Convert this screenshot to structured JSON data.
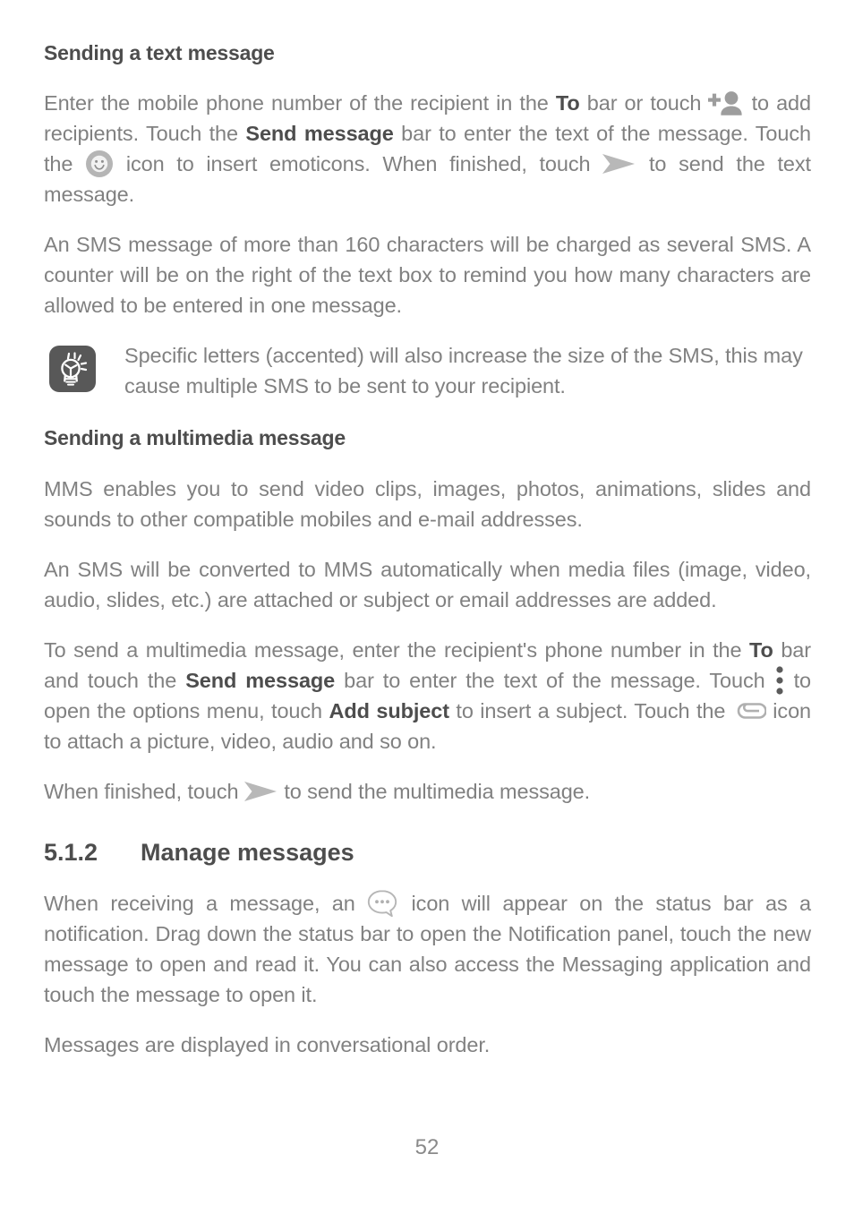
{
  "document": {
    "page_number": "52",
    "colors": {
      "heading": "#4d4d4d",
      "body": "#818181",
      "icon_gray": "#a8a8a8",
      "note_bg": "#585858",
      "background": "#ffffff"
    }
  },
  "sections": {
    "text_message": {
      "heading": "Sending a text message",
      "paragraph_1": {
        "part_1": "Enter the mobile phone number of the recipient in the ",
        "bold_1": "To",
        "part_2": " bar or touch ",
        "icon_1": "add-person-icon",
        "part_3": " to add recipients. Touch the ",
        "bold_2": "Send message",
        "part_4": " bar to enter the text of the message. Touch the ",
        "icon_2": "emoticon-icon",
        "part_5": " icon to insert emoticons. When finished, touch ",
        "icon_3": "send-icon",
        "part_6": " to send the text message."
      },
      "paragraph_2": "An SMS message of more than 160 characters will be charged as several SMS. A counter will be on the right of the text box to remind you how many characters are allowed to be entered in one message.",
      "note": {
        "icon": "lightbulb-tip-icon",
        "text": "Specific letters (accented) will also increase the size of the SMS, this may cause multiple SMS to be sent to your recipient."
      }
    },
    "multimedia_message": {
      "heading": "Sending a multimedia message",
      "paragraph_1": "MMS enables you to send video clips, images, photos, animations, slides and sounds to other compatible mobiles and e-mail addresses.",
      "paragraph_2": "An SMS will be converted to MMS automatically when media files (image, video, audio, slides, etc.) are attached or subject or email addresses are added.",
      "paragraph_3": {
        "part_1": "To send a multimedia message, enter the recipient's phone number in the ",
        "bold_1": "To",
        "part_2": " bar and touch the ",
        "bold_2": "Send message",
        "part_3": " bar to enter the text of the message. Touch ",
        "icon_1": "kebab-menu-icon",
        "part_4": " to open the options menu, touch ",
        "bold_3": "Add subject",
        "part_5": " to insert a subject. Touch the ",
        "icon_2": "attach-icon",
        "part_6": " icon to attach a picture, video, audio and so on."
      },
      "paragraph_4": {
        "part_1": "When finished, touch ",
        "icon_1": "send-icon",
        "part_2": " to send the multimedia message."
      }
    },
    "manage_messages": {
      "number": "5.1.2",
      "heading": "Manage messages",
      "paragraph_1": {
        "part_1": "When receiving a message, an ",
        "icon_1": "message-bubble-icon",
        "part_2": " icon will appear on the status bar as a notification. Drag down the status bar to open the Notification panel, touch the new message to open and read it. You can also access the Messaging application and touch the message to open it."
      },
      "paragraph_2": "Messages are displayed in conversational order."
    }
  }
}
